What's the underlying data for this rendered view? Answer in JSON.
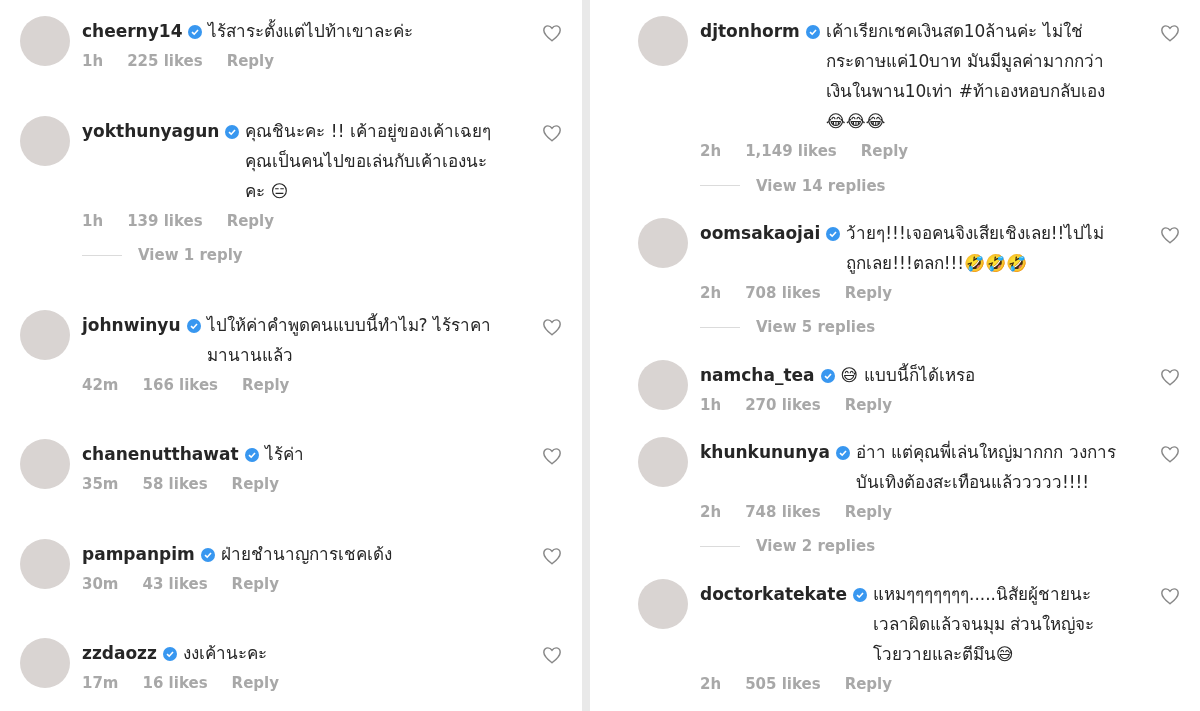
{
  "columns": [
    {
      "comments": [
        {
          "username": "cheerny14",
          "verified": true,
          "text": "ไร้สาระตั้งแต่ไปท้าเขาละค่ะ",
          "time": "1h",
          "likes": "225 likes",
          "reply": "Reply",
          "liked": false
        },
        {
          "username": "yokthunyagun",
          "verified": true,
          "text": "คุณชินะคะ !! เค้าอยู่ของเค้าเฉยๆ คุณเป็นคนไปขอเล่นกับเค้าเองนะคะ 😑",
          "time": "1h",
          "likes": "139 likes",
          "reply": "Reply",
          "liked": false,
          "view_replies": "View 1 reply"
        },
        {
          "username": "johnwinyu",
          "verified": true,
          "text": "ไปให้ค่าคำพูดคนแบบนี้ทำไม? ไร้ราคา มานานแล้ว",
          "time": "42m",
          "likes": "166 likes",
          "reply": "Reply",
          "liked": false
        },
        {
          "username": "chanenutthawat",
          "verified": true,
          "text": "ไร้ค่า",
          "time": "35m",
          "likes": "58 likes",
          "reply": "Reply",
          "liked": false
        },
        {
          "username": "pampanpim",
          "verified": true,
          "text": "ฝ่ายชำนาญการเชคเด้ง",
          "time": "30m",
          "likes": "43 likes",
          "reply": "Reply",
          "liked": false
        },
        {
          "username": "zzdaozz",
          "verified": true,
          "text": "งงเค้านะคะ",
          "time": "17m",
          "likes": "16 likes",
          "reply": "Reply",
          "liked": false
        }
      ]
    },
    {
      "comments": [
        {
          "username": "djtonhorm",
          "verified": true,
          "text": "เค้าเรียกเชคเงินสด10ล้านค่ะ ไม่ใช่กระดาษแค่10บาท มันมีมูลค่ามากกว่าเงินในพาน10เท่า #ท้าเองหอบกลับเอง 😂😂😂",
          "time": "2h",
          "likes": "1,149 likes",
          "reply": "Reply",
          "liked": false,
          "view_replies": "View 14 replies"
        },
        {
          "username": "oomsakaojai",
          "verified": true,
          "text": "ว้ายๆ!!!เจอคนจิงเสียเชิงเลย!!ไปไม่ถูกเลย!!!ตลก!!!🤣🤣🤣",
          "time": "2h",
          "likes": "708 likes",
          "reply": "Reply",
          "liked": false,
          "view_replies": "View 5 replies"
        },
        {
          "username": "namcha_tea",
          "verified": true,
          "text": "😅 แบบนี้ก็ได้เหรอ",
          "time": "1h",
          "likes": "270 likes",
          "reply": "Reply",
          "liked": false
        },
        {
          "username": "khunkununya",
          "verified": true,
          "text": "อ่าา แต่คุณพี่เล่นใหญ่มากกก วงการบันเทิงต้องสะเทือนแล้ววววว!!!!",
          "time": "2h",
          "likes": "748 likes",
          "reply": "Reply",
          "liked": false,
          "view_replies": "View 2 replies"
        },
        {
          "username": "doctorkatekate",
          "verified": true,
          "text": "แหมๆๆๆๆๆๆๆ.....นิสัยผู้ชายนะ เวลาผิดแล้วจนมุม ส่วนใหญ่จะโวยวายและตีมึน😅",
          "time": "2h",
          "likes": "505 likes",
          "reply": "Reply",
          "liked": false
        }
      ]
    }
  ]
}
